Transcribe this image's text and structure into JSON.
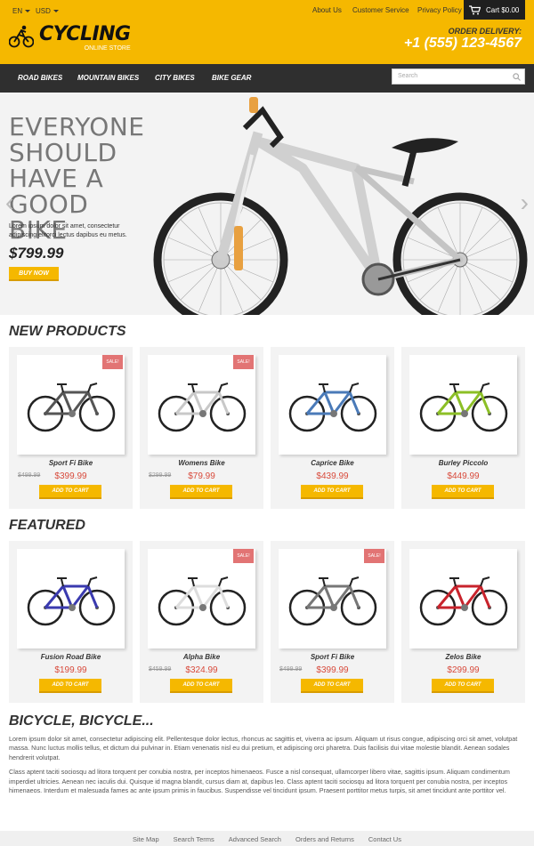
{
  "header": {
    "language": "EN",
    "currency": "USD",
    "links": [
      "About Us",
      "Customer Service",
      "Privacy Policy"
    ],
    "cart_label": "Cart $0.00",
    "logo_main": "CYCLING",
    "logo_sub": "ONLINE STORE",
    "delivery_label": "ORDER DELIVERY:",
    "phone": "+1 (555) 123-4567"
  },
  "nav": {
    "items": [
      "ROAD BIKES",
      "MOUNTAIN BIKES",
      "CITY BIKES",
      "BIKE GEAR"
    ],
    "search_placeholder": "Search"
  },
  "hero": {
    "headline_lines": [
      "EVERYONE",
      "SHOULD",
      "HAVE A",
      "GOOD BIKE"
    ],
    "description": "Lorem ipsum dolor sit amet, consectetur adipiscing elitorci lectus dapibus eu metus.",
    "price": "$799.99",
    "buy_label": "BUY NOW",
    "prev_arrow": "‹",
    "next_arrow": "›"
  },
  "new_products": {
    "title": "NEW PRODUCTS",
    "items": [
      {
        "name": "Sport Fi Bike",
        "old_price": "$499.99",
        "price": "$399.99",
        "sale": "SALE!",
        "button": "ADD TO CART",
        "frame_color": "#555555"
      },
      {
        "name": "Womens Bike",
        "old_price": "$299.99",
        "price": "$79.99",
        "sale": "SALE!",
        "button": "ADD TO CART",
        "frame_color": "#c8c8c8"
      },
      {
        "name": "Caprice Bike",
        "old_price": "",
        "price": "$439.99",
        "sale": "",
        "button": "ADD TO CART",
        "frame_color": "#4a7ab8"
      },
      {
        "name": "Burley Piccolo",
        "old_price": "",
        "price": "$449.99",
        "sale": "",
        "button": "ADD TO CART",
        "frame_color": "#8cbf26"
      }
    ]
  },
  "featured": {
    "title": "FEATURED",
    "items": [
      {
        "name": "Fusion Road Bike",
        "old_price": "",
        "price": "$199.99",
        "sale": "",
        "button": "ADD TO CART",
        "frame_color": "#3a3aaf"
      },
      {
        "name": "Alpha Bike",
        "old_price": "$459.99",
        "price": "$324.99",
        "sale": "SALE!",
        "button": "ADD TO CART",
        "frame_color": "#dddddd"
      },
      {
        "name": "Sport Fi Bike",
        "old_price": "$499.99",
        "price": "$399.99",
        "sale": "SALE!",
        "button": "ADD TO CART",
        "frame_color": "#777777"
      },
      {
        "name": "Zelos Bike",
        "old_price": "",
        "price": "$299.99",
        "sale": "",
        "button": "ADD TO CART",
        "frame_color": "#c8232c"
      }
    ]
  },
  "about": {
    "title": "BICYCLE, BICYCLE...",
    "paragraph1": "Lorem ipsum dolor sit amet, consectetur adipiscing elit. Pellentesque dolor lectus, rhoncus ac sagittis et, viverra ac ipsum. Aliquam ut risus congue, adipiscing orci sit amet, volutpat massa. Nunc luctus mollis tellus, et dictum dui pulvinar in. Etiam venenatis nisl eu dui pretium, et adipiscing orci pharetra. Duis facilisis dui vitae molestie blandit. Aenean sodales hendrerit volutpat.",
    "paragraph2": "Class aptent taciti sociosqu ad litora torquent per conubia nostra, per inceptos himenaeos. Fusce a nisl consequat, ullamcorper libero vitae, sagittis ipsum. Aliquam condimentum imperdiet ultricies. Aenean nec iaculis dui. Quisque id magna blandit, cursus diam at, dapibus leo. Class aptent taciti sociosqu ad litora torquent per conubia nostra, per inceptos himenaeos. Interdum et malesuada fames ac ante ipsum primis in faucibus. Suspendisse vel tincidunt ipsum. Praesent porttitor metus turpis, sit amet tincidunt ante porttitor vel."
  },
  "footer": {
    "links": [
      "Site Map",
      "Search Terms",
      "Advanced Search",
      "Orders and Returns",
      "Contact Us"
    ]
  },
  "colors": {
    "accent": "#f5b800",
    "nav_bg": "#2f2f2f",
    "sale_badge": "#e27474",
    "price": "#d84a3b"
  }
}
